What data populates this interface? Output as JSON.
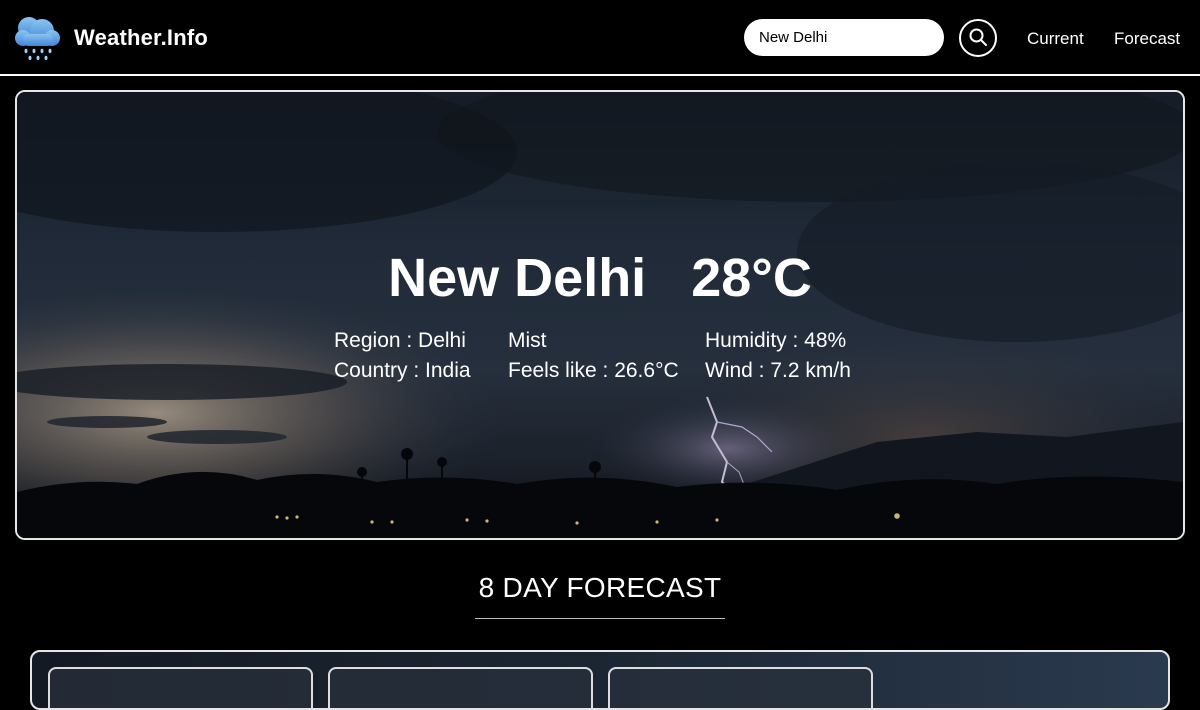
{
  "nav": {
    "brand": "Weather.Info",
    "search_value": "New Delhi",
    "links": [
      "Current",
      "Forecast"
    ]
  },
  "current": {
    "city": "New Delhi",
    "temp": "28°C",
    "region": "Region : Delhi",
    "country": "Country : India",
    "condition": "Mist",
    "feels_like": "Feels like : 26.6°C",
    "humidity": "Humidity : 48%",
    "wind": "Wind : 7.2 km/h"
  },
  "forecast": {
    "title": "8 DAY FORECAST"
  },
  "icons": {
    "logo": "rain-cloud-icon",
    "search": "search-icon"
  },
  "colors": {
    "background": "#000000",
    "text": "#ffffff",
    "cloud_icon": "#5aa0e6"
  }
}
